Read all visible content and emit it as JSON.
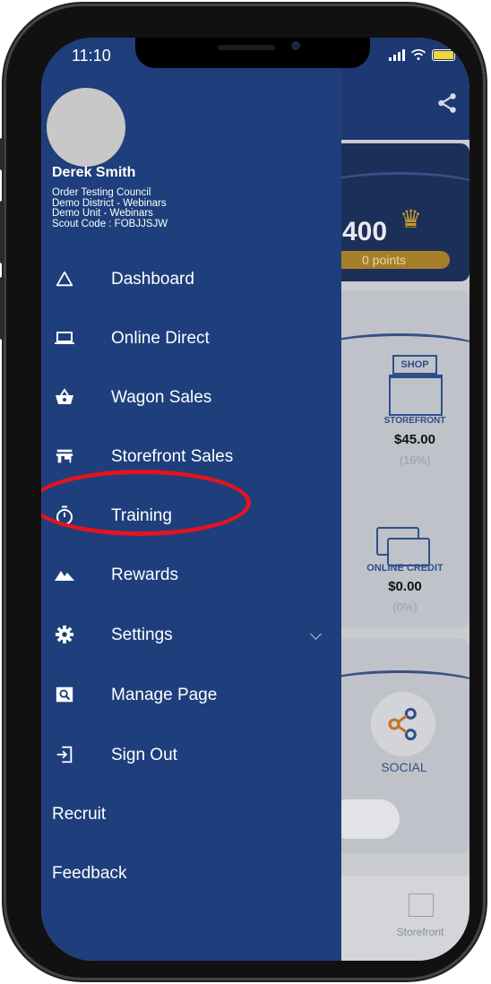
{
  "status_bar": {
    "time": "11:10"
  },
  "user": {
    "name": "Derek Smith",
    "info_lines": [
      "Order Testing Council",
      "Demo District - Webinars",
      "Demo Unit - Webinars",
      "Scout Code : FOBJJSJW"
    ]
  },
  "menu": [
    {
      "label": "Dashboard",
      "icon": "triangle-icon"
    },
    {
      "label": "Online Direct",
      "icon": "laptop-icon"
    },
    {
      "label": "Wagon Sales",
      "icon": "basket-icon"
    },
    {
      "label": "Storefront Sales",
      "icon": "store-icon"
    },
    {
      "label": "Training",
      "icon": "stopwatch-icon"
    },
    {
      "label": "Rewards",
      "icon": "mountains-icon"
    },
    {
      "label": "Settings",
      "icon": "gear-icon"
    },
    {
      "label": "Manage Page",
      "icon": "page-search-icon"
    },
    {
      "label": "Sign Out",
      "icon": "sign-out-icon"
    }
  ],
  "extra_links": [
    "Recruit",
    "Feedback"
  ],
  "background": {
    "score": "400",
    "points_text": "0 points",
    "storefront": {
      "label": "STOREFRONT",
      "amount": "$45.00",
      "percent": "(16%)",
      "sign": "SHOP"
    },
    "online_credit": {
      "label": "ONLINE CREDIT",
      "amount": "$0.00",
      "percent": "(0%)"
    },
    "social_label": "SOCIAL",
    "bottom_nav_label": "Storefront"
  },
  "colors": {
    "drawer_bg": "#1e3f7c",
    "highlight_ring": "#e3141e",
    "battery": "#f2d43c"
  }
}
